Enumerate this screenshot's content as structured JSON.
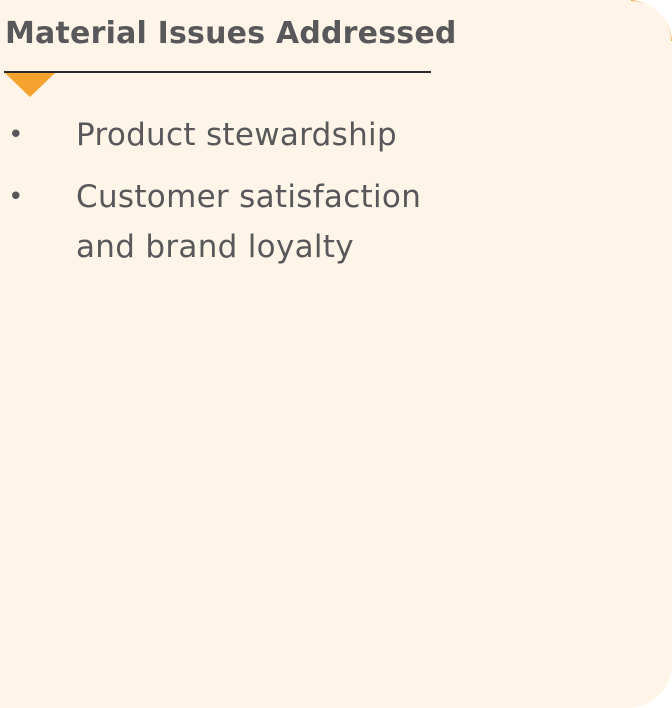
{
  "section": {
    "title": "Material Issues Addressed",
    "accent_color": "#f5a32e",
    "background_color": "#fff4e8",
    "text_color": "#58585a",
    "items": [
      {
        "bullet": "•",
        "text": "Product stewardship"
      },
      {
        "bullet": "•",
        "text": "Customer satisfaction and brand loyalty"
      }
    ]
  }
}
